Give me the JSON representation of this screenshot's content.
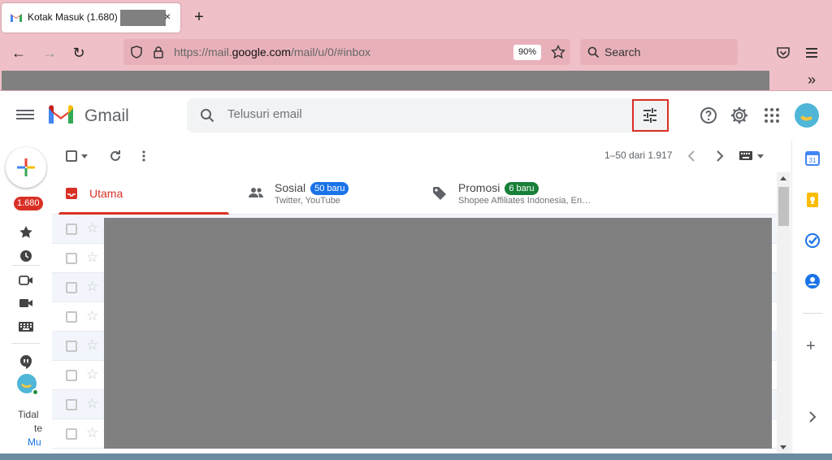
{
  "browser": {
    "tab_title": "Kotak Masuk (1.680) -",
    "close_glyph": "×",
    "newtab_glyph": "+",
    "url_prefix": "https://mail.",
    "url_domain": "google.com",
    "url_path": "/mail/u/0/#inbox",
    "zoom": "90%",
    "search_placeholder": "Search",
    "bookmark_overflow": "»"
  },
  "gmail": {
    "product_name": "Gmail",
    "search_placeholder": "Telusuri email",
    "unread_count": "1.680",
    "pagination": "1–50 dari 1.917",
    "rail_text": [
      "Tidal",
      "te",
      "Mu"
    ]
  },
  "tabs": [
    {
      "name": "Utama",
      "subtitle": "",
      "badge": ""
    },
    {
      "name": "Sosial",
      "subtitle": "Twitter, YouTube",
      "badge": "50 baru"
    },
    {
      "name": "Promosi",
      "subtitle": "Shopee Affiliates Indonesia, En…",
      "badge": "6 baru"
    }
  ],
  "colors": {
    "chrome_bg": "#f0c0c8",
    "accent_red": "#d93025",
    "social_badge": "#1a73e8",
    "promo_badge": "#188038"
  },
  "icons": {
    "star": "☆",
    "more": "⋮",
    "refresh": "↻",
    "back": "←",
    "forward": "→",
    "hamburger": "≡",
    "chevron_left": "‹",
    "chevron_right": "›",
    "plus": "+"
  }
}
